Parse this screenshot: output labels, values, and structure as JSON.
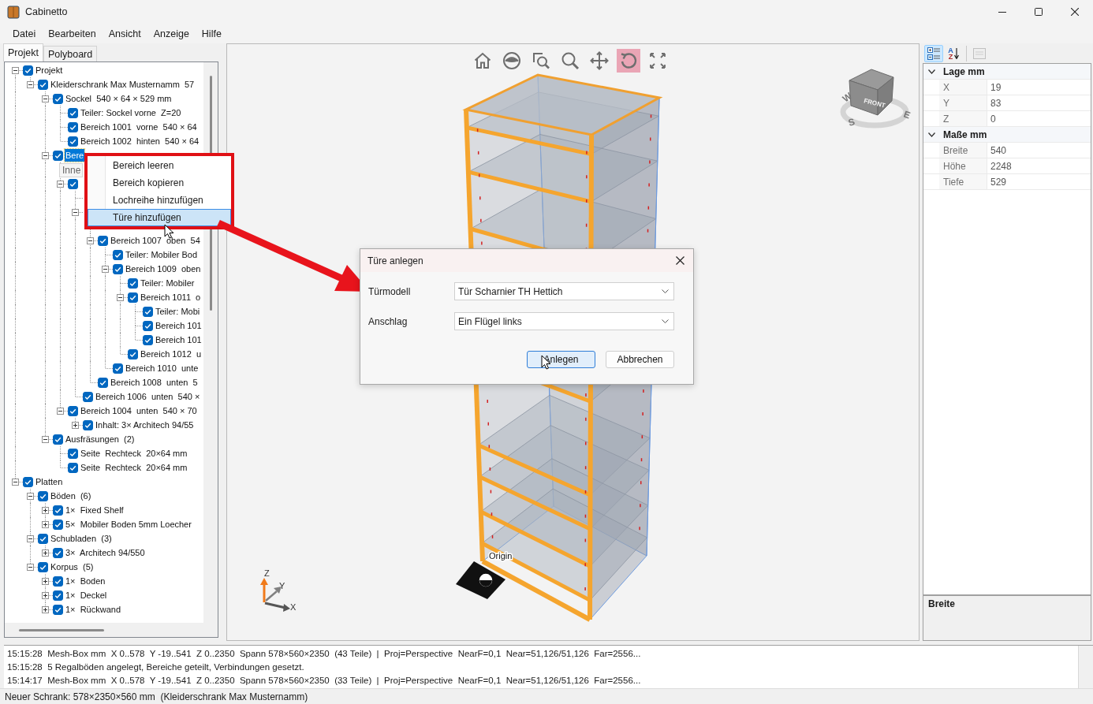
{
  "window": {
    "title": "Cabinetto"
  },
  "menu": [
    "Datei",
    "Bearbeiten",
    "Ansicht",
    "Anzeige",
    "Hilfe"
  ],
  "left_tabs": [
    {
      "label": "Projekt",
      "selected": true
    },
    {
      "label": "Polyboard",
      "selected": false
    }
  ],
  "tree": [
    {
      "kind": "row",
      "label": "Projekt",
      "checked": true,
      "selected": false,
      "expanded": true,
      "children": [
        {
          "kind": "row",
          "label": "Kleiderschrank Max Musternamm  57",
          "checked": true,
          "selected": false,
          "expanded": true,
          "children": [
            {
              "kind": "row",
              "label": "Sockel  540 × 64 × 529 mm",
              "checked": true,
              "selected": false,
              "expanded": true,
              "children": [
                {
                  "kind": "row",
                  "label": "Teiler: Sockel vorne  Z=20",
                  "checked": true,
                  "selected": false
                },
                {
                  "kind": "row",
                  "label": "Bereich 1001  vorne  540 × 64",
                  "checked": true,
                  "selected": false
                },
                {
                  "kind": "row",
                  "label": "Bereich 1002  hinten  540 × 64",
                  "checked": true,
                  "selected": false
                }
              ]
            },
            {
              "kind": "row",
              "label": "Bere",
              "checked": true,
              "selected": true,
              "expanded": true,
              "children": [
                {
                  "kind": "covered"
                },
                {
                  "kind": "row",
                  "checked": true,
                  "expanded": true,
                  "children": [
                    {
                      "kind": "covered"
                    },
                    {
                      "kind": "row",
                      "expanded": true,
                      "children": [
                        {
                          "kind": "covered"
                        },
                        {
                          "kind": "row",
                          "label": "Bereich 1007  oben  54",
                          "checked": true,
                          "selected": false,
                          "expanded": true,
                          "children": [
                            {
                              "kind": "row",
                              "label": "Teiler: Mobiler Bod",
                              "checked": true,
                              "selected": false
                            },
                            {
                              "kind": "row",
                              "label": "Bereich 1009  oben",
                              "checked": true,
                              "selected": false,
                              "expanded": true,
                              "children": [
                                {
                                  "kind": "row",
                                  "label": "Teiler: Mobiler",
                                  "checked": true,
                                  "selected": false
                                },
                                {
                                  "kind": "row",
                                  "label": "Bereich 1011  o",
                                  "checked": true,
                                  "selected": false,
                                  "expanded": true,
                                  "children": [
                                    {
                                      "kind": "row",
                                      "label": "Teiler: Mobi",
                                      "checked": true,
                                      "selected": false
                                    },
                                    {
                                      "kind": "row",
                                      "label": "Bereich 101",
                                      "checked": true,
                                      "selected": false
                                    },
                                    {
                                      "kind": "row",
                                      "label": "Bereich 101",
                                      "checked": true,
                                      "selected": false
                                    }
                                  ]
                                },
                                {
                                  "kind": "row",
                                  "label": "Bereich 1012  u",
                                  "checked": true,
                                  "selected": false
                                }
                              ]
                            },
                            {
                              "kind": "row",
                              "label": "Bereich 1010  unte",
                              "checked": true,
                              "selected": false
                            }
                          ]
                        },
                        {
                          "kind": "row",
                          "label": "Bereich 1008  unten  5",
                          "checked": true,
                          "selected": false
                        }
                      ]
                    },
                    {
                      "kind": "row",
                      "label": "Bereich 1006  unten  540 ×",
                      "checked": true,
                      "selected": false
                    }
                  ]
                },
                {
                  "kind": "row",
                  "label": "Bereich 1004  unten  540 × 70",
                  "checked": true,
                  "selected": false,
                  "expanded": true,
                  "children": [
                    {
                      "kind": "row",
                      "label": "Inhalt: 3× Architech 94/55",
                      "checked": true,
                      "selected": false,
                      "expanded": false
                    }
                  ]
                }
              ]
            },
            {
              "kind": "row",
              "label": "Ausfräsungen  (2)",
              "checked": true,
              "selected": false,
              "expanded": true,
              "children": [
                {
                  "kind": "row",
                  "label": "Seite  Rechteck  20×64 mm",
                  "checked": true,
                  "selected": false
                },
                {
                  "kind": "row",
                  "label": "Seite  Rechteck  20×64 mm",
                  "checked": true,
                  "selected": false
                }
              ]
            }
          ]
        }
      ]
    },
    {
      "kind": "row",
      "label": "Platten",
      "checked": true,
      "selected": false,
      "expanded": true,
      "children": [
        {
          "kind": "row",
          "label": "Böden  (6)",
          "checked": true,
          "selected": false,
          "expanded": true,
          "children": [
            {
              "kind": "row",
              "label": "1×  Fixed Shelf",
              "checked": true,
              "selected": false,
              "expanded": false
            },
            {
              "kind": "row",
              "label": "5×  Mobiler Boden 5mm Loecher",
              "checked": true,
              "selected": false,
              "expanded": false
            }
          ]
        },
        {
          "kind": "row",
          "label": "Schubladen  (3)",
          "checked": true,
          "selected": false,
          "expanded": true,
          "children": [
            {
              "kind": "row",
              "label": "3×  Architech 94/550",
              "checked": true,
              "selected": false,
              "expanded": false
            }
          ]
        },
        {
          "kind": "row",
          "label": "Korpus  (5)",
          "checked": true,
          "selected": false,
          "expanded": true,
          "children": [
            {
              "kind": "row",
              "label": "1×  Boden",
              "checked": true,
              "selected": false,
              "expanded": false
            },
            {
              "kind": "row",
              "label": "1×  Deckel",
              "checked": true,
              "selected": false,
              "expanded": false
            },
            {
              "kind": "row",
              "label": "1×  Rückwand",
              "checked": true,
              "selected": false,
              "expanded": false
            }
          ]
        }
      ]
    }
  ],
  "tooltip": "Inne",
  "context_menu": [
    {
      "label": "Bereich leeren",
      "selected": false
    },
    {
      "label": "Bereich kopieren",
      "selected": false
    },
    {
      "label": "Lochreihe hinzufügen",
      "selected": false
    },
    {
      "label": "Türe hinzufügen",
      "selected": true
    }
  ],
  "viewport": {
    "toolbar": [
      {
        "kind": "home",
        "selected": false
      },
      {
        "kind": "eye",
        "selected": false
      },
      {
        "kind": "zoom-window",
        "selected": false
      },
      {
        "kind": "zoom",
        "selected": false
      },
      {
        "kind": "pan",
        "selected": false
      },
      {
        "kind": "rotate",
        "selected": true
      },
      {
        "kind": "fit",
        "selected": false
      }
    ],
    "view_cube": {
      "face_label": "FRONT",
      "compass": [
        "W",
        "S",
        "E"
      ]
    },
    "origin_label": "Origin",
    "axes": [
      "Z",
      "Y",
      "X"
    ]
  },
  "dialog": {
    "title": "Türe anlegen",
    "fields": [
      {
        "label": "Türmodell",
        "value": "Tür Scharnier TH Hettich"
      },
      {
        "label": "Anschlag",
        "value": "Ein Flügel links"
      }
    ],
    "buttons": [
      {
        "label": "Anlegen",
        "default": true
      },
      {
        "label": "Abbrechen",
        "default": false
      }
    ]
  },
  "properties": {
    "toolbar": [
      {
        "kind": "categorized",
        "selected": true,
        "disabled": false
      },
      {
        "kind": "alphabetical",
        "selected": false,
        "disabled": false,
        "letters": [
          "A",
          "Z"
        ]
      },
      {
        "kind": "pages",
        "selected": false,
        "disabled": true
      }
    ],
    "categories": [
      {
        "title": "Lage mm",
        "expanded": true,
        "rows": [
          {
            "name": "X",
            "value": "19"
          },
          {
            "name": "Y",
            "value": "83"
          },
          {
            "name": "Z",
            "value": "0"
          }
        ]
      },
      {
        "title": "Maße mm",
        "expanded": true,
        "rows": [
          {
            "name": "Breite",
            "value": "540"
          },
          {
            "name": "Höhe",
            "value": "2248"
          },
          {
            "name": "Tiefe",
            "value": "529"
          }
        ]
      }
    ],
    "description": {
      "title": "Breite"
    }
  },
  "log": [
    "15:15:28  Mesh-Box mm  X 0..578  Y -19..541  Z 0..2350  Spann 578×560×2350  (43 Teile)  |  Proj=Perspective  NearF=0,1  Near=51,126/51,126  Far=2556...",
    "15:15:28  5 Regalböden angelegt, Bereiche geteilt, Verbindungen gesetzt.",
    "15:14:17  Mesh-Box mm  X 0..578  Y -19..541  Z 0..2350  Spann 578×560×2350  (33 Teile)  |  Proj=Perspective  NearF=0,1  Near=51,126/51,126  Far=2556..."
  ],
  "status_bar": "Neuer Schrank: 578×2350×560 mm  (Kleiderschrank Max Musternamm)"
}
